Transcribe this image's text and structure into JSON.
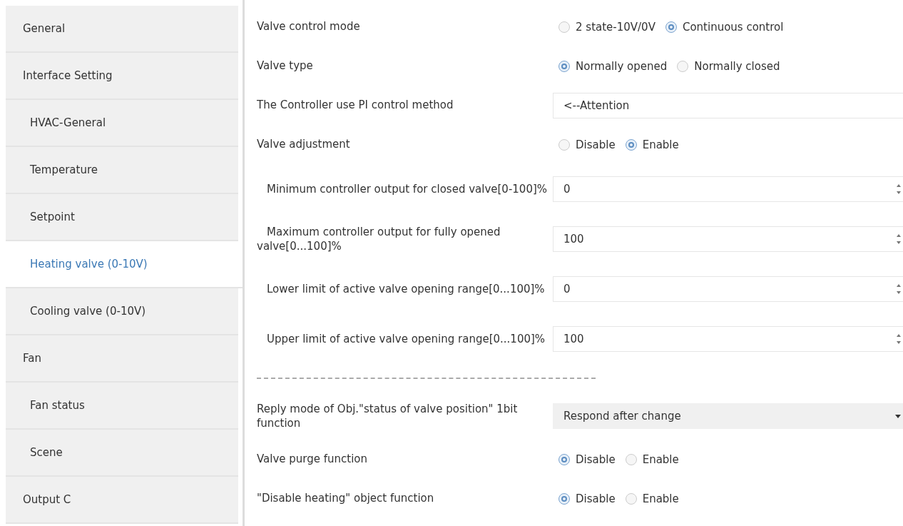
{
  "sidebar": {
    "items": [
      {
        "label": "General",
        "selected": false
      },
      {
        "label": "Interface Setting",
        "selected": false,
        "children": [
          {
            "label": "HVAC-General",
            "selected": false
          },
          {
            "label": "Temperature",
            "selected": false
          },
          {
            "label": "Setpoint",
            "selected": false
          },
          {
            "label": "Heating valve (0-10V)",
            "selected": true
          },
          {
            "label": "Cooling valve (0-10V)",
            "selected": false
          }
        ]
      },
      {
        "label": "Fan",
        "selected": false,
        "children": [
          {
            "label": "Fan status",
            "selected": false
          },
          {
            "label": "Scene",
            "selected": false
          }
        ]
      },
      {
        "label": "Output C",
        "selected": false
      }
    ]
  },
  "parameters": [
    {
      "kind": "radio",
      "label": "Valve control mode",
      "options": [
        {
          "label": "2 state-10V/0V",
          "selected": false
        },
        {
          "label": "Continuous control",
          "selected": true
        }
      ]
    },
    {
      "kind": "radio",
      "label": "Valve type",
      "options": [
        {
          "label": "Normally opened",
          "selected": true
        },
        {
          "label": "Normally closed",
          "selected": false
        }
      ]
    },
    {
      "kind": "text",
      "label": "The Controller use PI control method",
      "value": "<--Attention"
    },
    {
      "kind": "radio",
      "label": "Valve adjustment",
      "options": [
        {
          "label": "Disable",
          "selected": false
        },
        {
          "label": "Enable",
          "selected": true
        }
      ]
    },
    {
      "kind": "spin",
      "label": "Minimum controller output for closed valve[0-100]%",
      "value": "0"
    },
    {
      "kind": "spin",
      "label": "Maximum controller output for fully opened valve[0...100]%",
      "value": "100"
    },
    {
      "kind": "spin",
      "label": "Lower limit of active valve opening range[0...100]%",
      "value": "0"
    },
    {
      "kind": "spin",
      "label": "Upper limit of active valve opening range[0...100]%",
      "value": "100"
    },
    {
      "kind": "separator"
    },
    {
      "kind": "dropdown",
      "label": "Reply mode of Obj.\"status of valve position\" 1bit function",
      "value": "Respond after change"
    },
    {
      "kind": "radio",
      "label": "Valve purge function",
      "options": [
        {
          "label": "Disable",
          "selected": true
        },
        {
          "label": "Enable",
          "selected": false
        }
      ]
    },
    {
      "kind": "radio",
      "label": "\"Disable heating\" object function",
      "options": [
        {
          "label": "Disable",
          "selected": true
        },
        {
          "label": "Enable",
          "selected": false
        }
      ]
    }
  ]
}
